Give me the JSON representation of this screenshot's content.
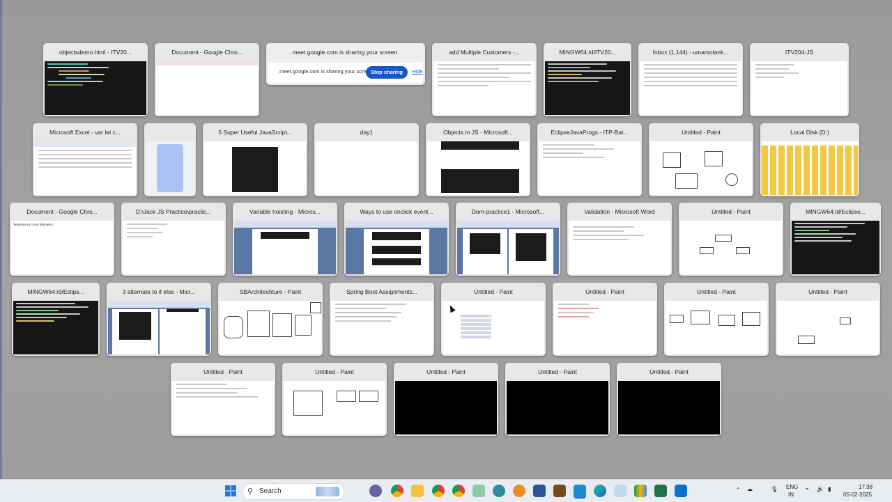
{
  "windows": [
    {
      "title": "objectsdemo.html - ITV20..."
    },
    {
      "title": "Document - Google Chro..."
    },
    {
      "title": "meet.google.com is sharing your screen."
    },
    {
      "title": "add Multiple Customers -..."
    },
    {
      "title": "MINGW64:/d/ITV20..."
    },
    {
      "title": "Inbox (1,144) - umarsolank..."
    },
    {
      "title": "ITV204-JS"
    },
    {
      "title": "Microsoft Excel - var let c..."
    },
    {
      "title": ""
    },
    {
      "title": "5 Super Useful JavaScript..."
    },
    {
      "title": "day1"
    },
    {
      "title": "Objects In JS - Microsoft..."
    },
    {
      "title": "EclipseJavaProgs - ITP-Bat..."
    },
    {
      "title": "Untitled - Paint"
    },
    {
      "title": "Local Disk (D:)"
    },
    {
      "title": "Document - Google Chro..."
    },
    {
      "title": "D:\\Jack JS Practice\\practic..."
    },
    {
      "title": "Variable hoisting - Micros..."
    },
    {
      "title": "Ways to use onclick event..."
    },
    {
      "title": "Dom-practice1 - Microsoft..."
    },
    {
      "title": "Validation - Microsoft Word"
    },
    {
      "title": "Untitled - Paint"
    },
    {
      "title": "MINGW64:/d/Eclipse..."
    },
    {
      "title": "MINGW64:/d/Eclips..."
    },
    {
      "title": "3 alternate to if else - Micr..."
    },
    {
      "title": "SBArchitechture - Paint"
    },
    {
      "title": "Spring Boot Assignments..."
    },
    {
      "title": "Untitled - Paint"
    },
    {
      "title": "Untitled - Paint"
    },
    {
      "title": "Untitled - Paint"
    },
    {
      "title": "Untitled - Paint"
    },
    {
      "title": "Untitled - Paint"
    },
    {
      "title": "Untitled - Paint"
    },
    {
      "title": "Untitled - Paint"
    },
    {
      "title": "Untitled - Paint"
    },
    {
      "title": "Untitled - Paint"
    }
  ],
  "share_banner": {
    "message": "meet.google.com is sharing your screen.",
    "stop_label": "Stop sharing",
    "hide_label": "Hide"
  },
  "doc_thumb_text": "Welcome to Great Mayberry",
  "taskbar": {
    "search_label": "Search",
    "language": "ENG",
    "region": "IN",
    "time": "17:38",
    "date": "05-02-2025",
    "icons": [
      "windows-start",
      "search",
      "file-explorer",
      "teams",
      "chrome",
      "folder",
      "chrome",
      "chrome",
      "notepad",
      "photos",
      "vlc",
      "word",
      "snip",
      "vscode",
      "edge",
      "mail",
      "excel",
      "remote-desktop"
    ]
  }
}
